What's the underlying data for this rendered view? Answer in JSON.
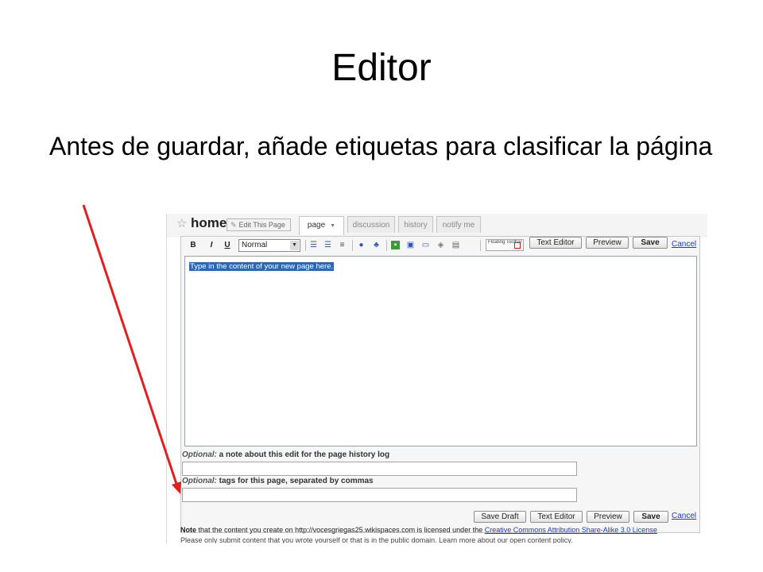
{
  "slide": {
    "title": "Editor",
    "body": "Antes de guardar, añade etiquetas para clasificar la página"
  },
  "page": {
    "title": "home",
    "edit_button": "Edit This Page",
    "tabs": [
      {
        "label": "page",
        "active": true
      },
      {
        "label": "discussion",
        "active": false
      },
      {
        "label": "history",
        "active": false
      },
      {
        "label": "notify me",
        "active": false
      }
    ]
  },
  "toolbar": {
    "bold": "B",
    "italic": "I",
    "underline": "U",
    "format_select": "Normal",
    "floating_toolbar": "Floating Toolbar",
    "text_editor": "Text Editor",
    "preview": "Preview",
    "save": "Save",
    "cancel": "Cancel",
    "icons": [
      "ordered-list-icon",
      "unordered-list-icon",
      "horizontal-rule-icon",
      "link-icon",
      "external-link-icon",
      "image-icon",
      "file-icon",
      "table-icon",
      "widget-icon",
      "source-icon"
    ]
  },
  "editor": {
    "placeholder": "Type in the content of your new page here."
  },
  "form": {
    "note_label_italic": "Optional:",
    "note_label_rest": " a note about this edit for the page history log",
    "tags_label_italic": "Optional:",
    "tags_label_rest": " tags for this page, separated by commas"
  },
  "bottom_buttons": {
    "save_draft": "Save Draft",
    "text_editor": "Text Editor",
    "preview": "Preview",
    "save": "Save",
    "cancel": "Cancel"
  },
  "footer": {
    "note_bold": "Note",
    "note_text": " that the content you create on http://vocesgriegas25.wikispaces.com is licensed under the ",
    "license_link": "Creative Commons Attribution Share-Alike 3.0 License",
    "note_line2": "Please only submit content that you wrote yourself or that is in the public domain. Learn more about our open content policy."
  },
  "colors": {
    "arrow": "#e02020",
    "link": "#1a3cc4",
    "selection": "#2f65b5"
  }
}
